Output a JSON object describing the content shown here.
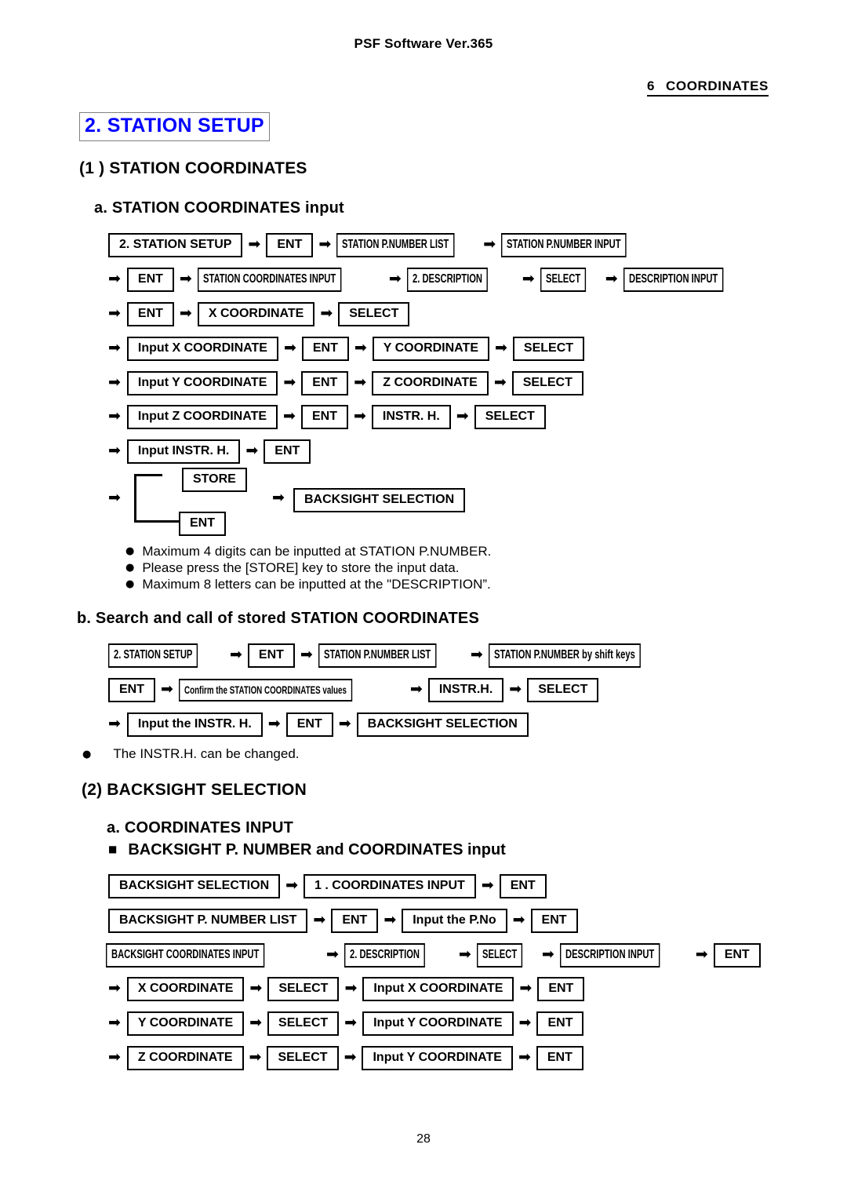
{
  "header": {
    "software_title": "PSF Software Ver.365",
    "chapter_number": "6",
    "chapter_name": "COORDINATES"
  },
  "title": "2. STATION SETUP",
  "section1": {
    "heading": "(1 ) STATION COORDINATES",
    "sub_a": {
      "heading": "a. STATION COORDINATES input",
      "rows": [
        [
          "2. STATION SETUP",
          "ENT",
          "STATION P.NUMBER LIST",
          "STATION P.NUMBER INPUT"
        ],
        [
          "ENT",
          "STATION COORDINATES INPUT",
          "2. DESCRIPTION",
          "SELECT",
          "DESCRIPTION INPUT"
        ],
        [
          "ENT",
          "X COORDINATE",
          "SELECT"
        ],
        [
          "Input X COORDINATE",
          "ENT",
          "Y COORDINATE",
          "SELECT"
        ],
        [
          "Input Y COORDINATE",
          "ENT",
          "Z COORDINATE",
          "SELECT"
        ],
        [
          "Input Z COORDINATE",
          "ENT",
          "INSTR. H.",
          "SELECT"
        ],
        [
          "Input INSTR. H.",
          "ENT"
        ]
      ],
      "branch": {
        "top_label": "STORE",
        "bottom_label": "ENT",
        "target_label": "BACKSIGHT SELECTION"
      },
      "notes": [
        "Maximum 4 digits can be inputted at STATION P.NUMBER.",
        "Please press the [STORE] key to store the input data.",
        "Maximum 8 letters can be inputted at the \"DESCRIPTION”."
      ]
    },
    "sub_b": {
      "heading": "b. Search and call of stored STATION COORDINATES",
      "rows": [
        [
          "2. STATION SETUP",
          "ENT",
          "STATION P.NUMBER LIST",
          "STATION P.NUMBER by shift keys"
        ],
        [
          "ENT",
          "Confirm the STATION COORDINATES values",
          "INSTR.H.",
          "SELECT"
        ],
        [
          "Input the INSTR. H.",
          "ENT",
          "BACKSIGHT SELECTION"
        ]
      ],
      "note": "The INSTR.H. can be changed."
    }
  },
  "section2": {
    "heading": "(2) BACKSIGHT SELECTION",
    "sub_a": {
      "heading": "a. COORDINATES INPUT",
      "sub_heading": "BACKSIGHT P. NUMBER and COORDINATES input",
      "rows": [
        [
          "BACKSIGHT SELECTION",
          "1 . COORDINATES INPUT",
          "ENT"
        ],
        [
          "BACKSIGHT P. NUMBER LIST",
          "ENT",
          "Input the P.No",
          "ENT"
        ],
        [
          "BACKSIGHT COORDINATES INPUT",
          "2. DESCRIPTION",
          "SELECT",
          "DESCRIPTION INPUT",
          "ENT"
        ],
        [
          "X COORDINATE",
          "SELECT",
          "Input X COORDINATE",
          "ENT"
        ],
        [
          "Y COORDINATE",
          "SELECT",
          "Input Y COORDINATE",
          "ENT"
        ],
        [
          "Z COORDINATE",
          "SELECT",
          "Input Y COORDINATE",
          "ENT"
        ]
      ]
    }
  },
  "page_number": "28",
  "colors": {
    "title_text": "#0000ff",
    "body_text": "#000000",
    "node_border": "#000000"
  }
}
